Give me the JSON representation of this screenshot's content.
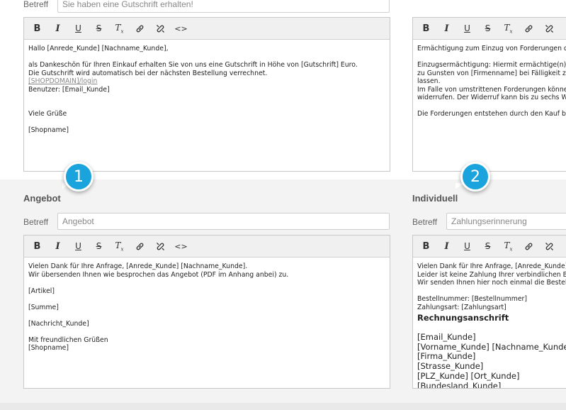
{
  "top_left": {
    "subject_label": "Betreff",
    "subject_value": "Sie haben eine Gutschrift erhalten!",
    "body": {
      "line1": "Hallo [Anrede_Kunde] [Nachname_Kunde],",
      "line2": "als Dankeschön für Ihren Einkauf erhalten Sie von uns eine Gutschrift in Höhe von [Gutschrift] Euro.",
      "line3": "Die Gutschrift wird automatisch bei der nächsten Bestellung verrechnet.",
      "link": "[SHOPDOMAIN]/login",
      "line4": "Benutzer: [Email_Kunde]",
      "line5": "Viele Grüße",
      "line6": "[Shopname]"
    }
  },
  "top_right": {
    "body": {
      "line1": "Ermächtigung zum Einzug von Forderungen dur",
      "line2": "Einzugsermächtigung: Hiermit ermächtige(n) ich",
      "line3": "zu Gunsten von [Firmenname] bei Fälligkeit zu L",
      "line4": "lassen.",
      "line5": "Im Falle von umstrittenen Forderungen können",
      "line6": "widerrufen. Der Widerruf kann bis zu sechs Wo",
      "line7": "Die Forderungen entstehen durch den Kauf be"
    }
  },
  "badges": {
    "one": "1",
    "two": "2"
  },
  "angebot": {
    "title": "Angebot",
    "subject_label": "Betreff",
    "subject_value": "Angebot",
    "body": {
      "line1": "Vielen Dank für Ihre Anfrage, [Anrede_Kunde] [Nachname_Kunde].",
      "line2": "Wir übersenden Ihnen wie besprochen das Angebot (PDF im Anhang anbei) zu.",
      "line3": "[Artikel]",
      "line4": "[Summe]",
      "line5": "[Nachricht_Kunde]",
      "line6": "Mit freundlichen Grüßen",
      "line7": "[Shopname]"
    }
  },
  "individuell": {
    "title": "Individuell",
    "subject_label": "Betreff",
    "subject_value": "Zahlungserinnerung",
    "body": {
      "line1": "Vielen Dank für Ihre Anfrage, [Anrede_Kunde]",
      "line2": "Leider ist keine Zahlung Ihrer verbindlichen Best",
      "line3": "Wir senden Ihnen hier noch einmal die Bestelld",
      "line4": "Bestellnummer: [Bestellnummer]",
      "line5": "Zahlungsart: [Zahlungsart]",
      "heading": "Rechnungsanschrift",
      "addr1": "[Email_Kunde]",
      "addr2": "[Vorname_Kunde] [Nachname_Kunde",
      "addr3": "[Firma_Kunde]",
      "addr4": "[Strasse_Kunde]",
      "addr5": "[PLZ_Kunde] [Ort_Kunde]",
      "addr6": "[Bundesland_Kunde]"
    }
  },
  "toolbar": {
    "bold": "B",
    "italic": "I",
    "underline": "U",
    "strike": "S",
    "clear": "T",
    "clear_sub": "x",
    "source": "<>"
  },
  "colors": {
    "badge": "#1aa3dc",
    "band": "#f3f3f3"
  }
}
